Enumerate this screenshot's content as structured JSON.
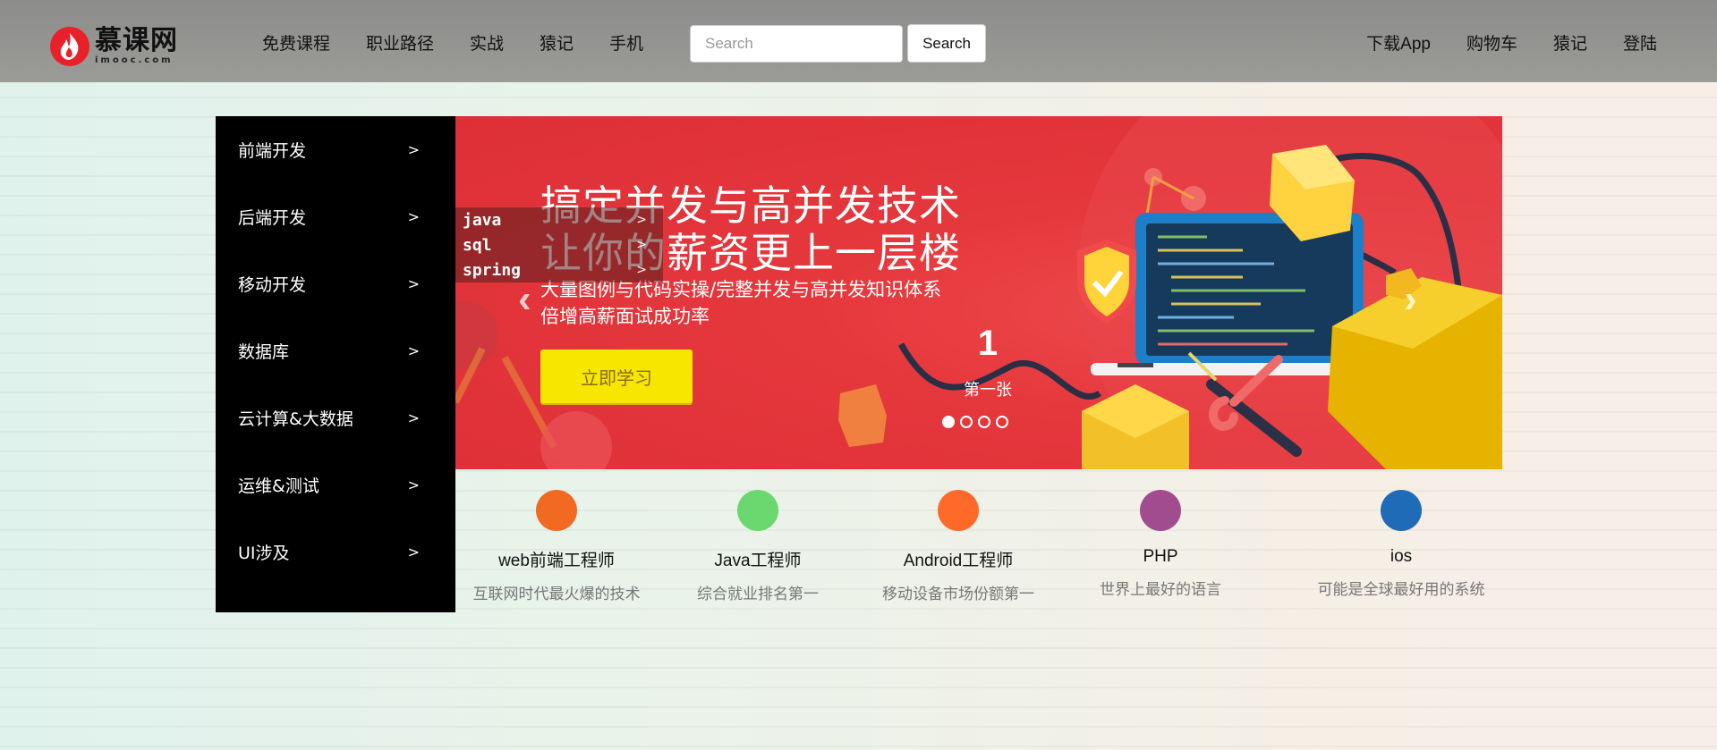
{
  "header": {
    "logo_cn": "慕课网",
    "logo_en": "imooc.com",
    "nav": [
      "免费课程",
      "职业路径",
      "实战",
      "猿记",
      "手机"
    ],
    "search_placeholder": "Search",
    "search_button": "Search",
    "nav_right": [
      "下载App",
      "购物车",
      "猿记",
      "登陆"
    ]
  },
  "sidebar": {
    "items": [
      {
        "label": "前端开发",
        "icon": "chevron-right-icon"
      },
      {
        "label": "后端开发",
        "icon": "chevron-right-icon"
      },
      {
        "label": "移动开发",
        "icon": "chevron-right-icon"
      },
      {
        "label": "数据库",
        "icon": "chevron-right-icon"
      },
      {
        "label": "云计算&大数据",
        "icon": "chevron-right-icon"
      },
      {
        "label": "运维&测试",
        "icon": "chevron-right-icon"
      },
      {
        "label": "UI涉及",
        "icon": "chevron-right-icon"
      }
    ],
    "chevron": ">"
  },
  "submenu": {
    "items": [
      "java",
      "sql",
      "spring"
    ]
  },
  "banner": {
    "headline_1": "搞定并发与高并发技术",
    "headline_2": "让你的薪资更上一层楼",
    "sub_1": "大量图例与代码实操/完整并发与高并发知识体系",
    "sub_2": "倍增高薪面试成功率",
    "cta": "立即学习",
    "slide_number": "1",
    "slide_caption": "第一张",
    "total_slides": 4,
    "active_slide": 1,
    "prev_arrow": "‹",
    "next_arrow": "›"
  },
  "careers": [
    {
      "title": "web前端工程师",
      "desc": "互联网时代最火爆的技术",
      "color": "#f26a21"
    },
    {
      "title": "Java工程师",
      "desc": "综合就业排名第一",
      "color": "#6ad86f"
    },
    {
      "title": "Android工程师",
      "desc": "移动设备市场份额第一",
      "color": "#ff6a2b"
    },
    {
      "title": "PHP",
      "desc": "世界上最好的语言",
      "color": "#a04c8e"
    },
    {
      "title": "ios",
      "desc": "可能是全球最好用的系统",
      "color": "#1f6bb8"
    }
  ],
  "colors": {
    "brand_red": "#e8202a",
    "banner_red": "#e5383d",
    "cta_yellow": "#f6e600"
  }
}
